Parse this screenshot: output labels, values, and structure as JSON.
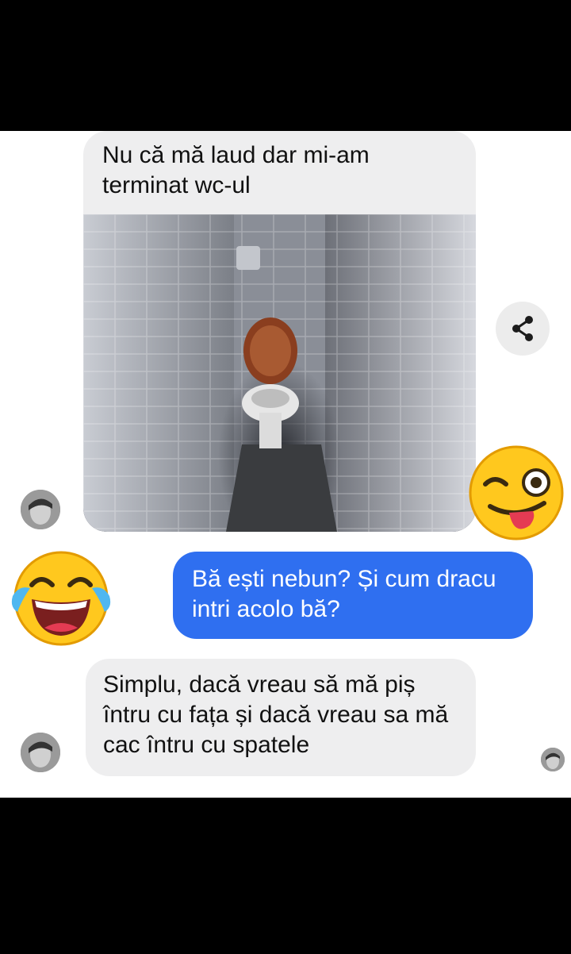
{
  "messages": {
    "incoming_1": "Nu că mă laud dar mi-am terminat wc-ul",
    "outgoing_1": "Bă ești nebun? Și cum dracu intri acolo bă?",
    "incoming_2": "Simplu, dacă vreau să mă piș întru cu fața și dacă vreau sa mă cac întru cu spatele"
  },
  "icons": {
    "share": "share-icon",
    "wink_emoji": "winking-face-with-tongue",
    "laugh_emoji": "face-with-tears-of-joy"
  },
  "colors": {
    "incoming_bubble": "#eeeeef",
    "outgoing_bubble": "#2f6ff0",
    "online_dot": "#2ec24b"
  }
}
